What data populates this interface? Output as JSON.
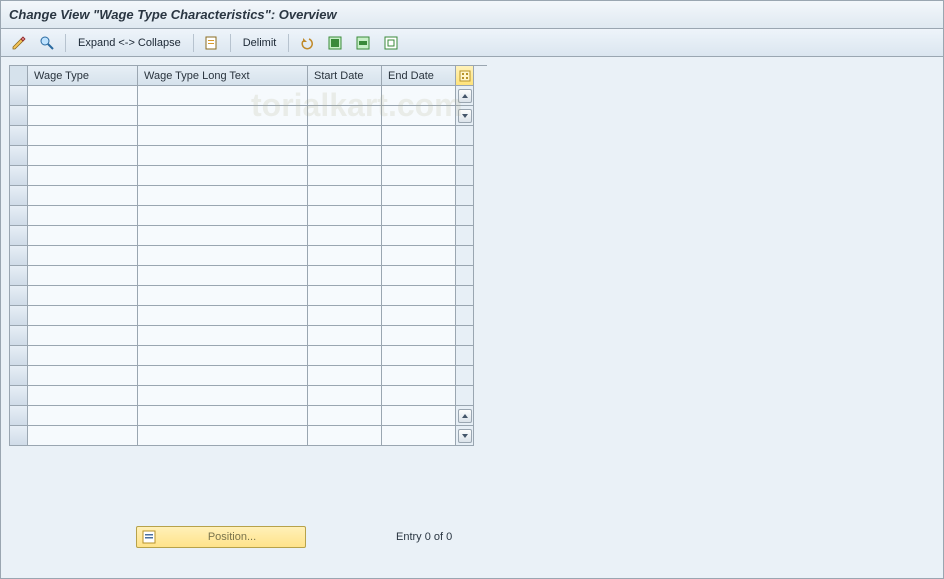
{
  "title": "Change View \"Wage Type Characteristics\": Overview",
  "toolbar": {
    "expand_collapse_label": "Expand <-> Collapse",
    "delimit_label": "Delimit"
  },
  "table": {
    "columns": {
      "wage_type": "Wage Type",
      "wage_type_long_text": "Wage Type Long Text",
      "start_date": "Start Date",
      "end_date": "End Date"
    },
    "rows": [
      {
        "wage_type": "",
        "long_text": "",
        "start": "",
        "end": ""
      },
      {
        "wage_type": "",
        "long_text": "",
        "start": "",
        "end": ""
      },
      {
        "wage_type": "",
        "long_text": "",
        "start": "",
        "end": ""
      },
      {
        "wage_type": "",
        "long_text": "",
        "start": "",
        "end": ""
      },
      {
        "wage_type": "",
        "long_text": "",
        "start": "",
        "end": ""
      },
      {
        "wage_type": "",
        "long_text": "",
        "start": "",
        "end": ""
      },
      {
        "wage_type": "",
        "long_text": "",
        "start": "",
        "end": ""
      },
      {
        "wage_type": "",
        "long_text": "",
        "start": "",
        "end": ""
      },
      {
        "wage_type": "",
        "long_text": "",
        "start": "",
        "end": ""
      },
      {
        "wage_type": "",
        "long_text": "",
        "start": "",
        "end": ""
      },
      {
        "wage_type": "",
        "long_text": "",
        "start": "",
        "end": ""
      },
      {
        "wage_type": "",
        "long_text": "",
        "start": "",
        "end": ""
      },
      {
        "wage_type": "",
        "long_text": "",
        "start": "",
        "end": ""
      },
      {
        "wage_type": "",
        "long_text": "",
        "start": "",
        "end": ""
      },
      {
        "wage_type": "",
        "long_text": "",
        "start": "",
        "end": ""
      },
      {
        "wage_type": "",
        "long_text": "",
        "start": "",
        "end": ""
      },
      {
        "wage_type": "",
        "long_text": "",
        "start": "",
        "end": ""
      },
      {
        "wage_type": "",
        "long_text": "",
        "start": "",
        "end": ""
      }
    ]
  },
  "footer": {
    "position_label": "Position...",
    "entry_text": "Entry 0 of 0"
  },
  "watermark": "torialkart.com"
}
